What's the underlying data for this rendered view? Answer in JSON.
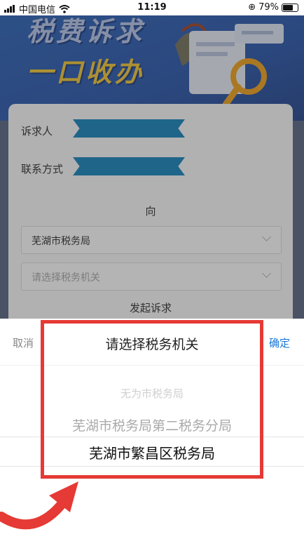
{
  "status_bar": {
    "carrier": "中国电信",
    "time": "11:19",
    "battery": "79%",
    "battery_level": 0.79
  },
  "banner": {
    "line1": "税费诉求",
    "line2": "一口收办"
  },
  "form": {
    "claimant_label": "诉求人",
    "contact_label": "联系方式",
    "to_label": "向",
    "office_value": "芜湖市税务局",
    "office_placeholder": "请选择税务机关",
    "submit_label": "发起诉求"
  },
  "picker": {
    "cancel_label": "取消",
    "title": "请选择税务机关",
    "confirm_label": "确定",
    "options": [
      "无为市税务局",
      "芜湖市税务局第二税务分局",
      "芜湖市繁昌区税务局"
    ]
  },
  "colors": {
    "accent": "#1a78d6",
    "highlight": "#e53a35",
    "banner_blue": "#2f66b9",
    "ribbon": "#1b86bd"
  }
}
